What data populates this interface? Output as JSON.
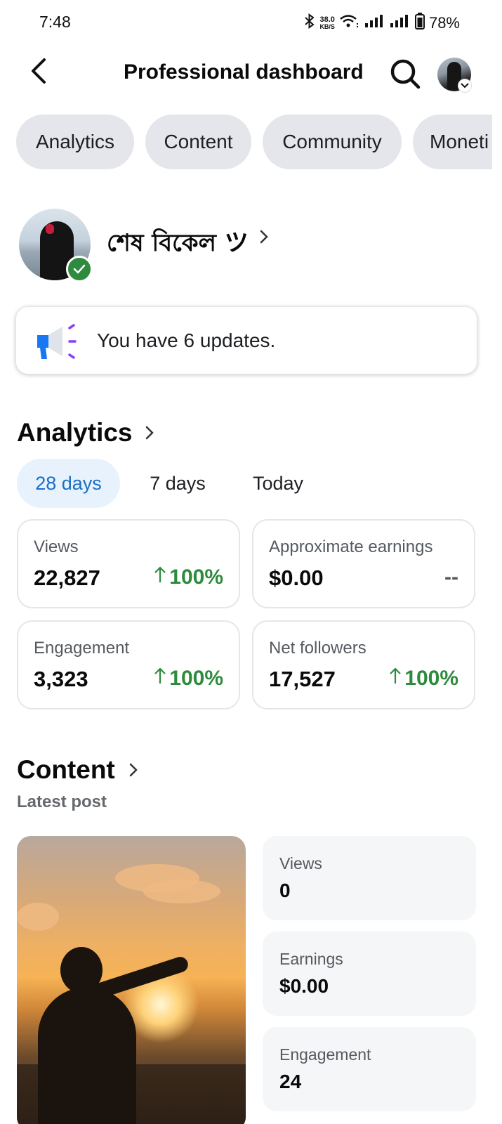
{
  "status_bar": {
    "time": "7:48",
    "net_speed_value": "38.0",
    "net_speed_unit": "KB/S",
    "battery": "78%"
  },
  "header": {
    "title": "Professional dashboard",
    "icons": [
      "back-arrow-icon",
      "search-icon",
      "avatar-menu-icon"
    ]
  },
  "tabs": [
    {
      "label": "Analytics"
    },
    {
      "label": "Content"
    },
    {
      "label": "Community"
    },
    {
      "label": "Moneti"
    }
  ],
  "profile": {
    "name": "শেষ বিকেল ツ",
    "verified": true
  },
  "updates": {
    "text": "You have 6 updates."
  },
  "analytics": {
    "title": "Analytics",
    "periods": [
      {
        "label": "28 days",
        "active": true
      },
      {
        "label": "7 days",
        "active": false
      },
      {
        "label": "Today",
        "active": false
      }
    ],
    "stats": [
      {
        "label": "Views",
        "value": "22,827",
        "change": "100%",
        "direction": "up"
      },
      {
        "label": "Approximate earnings",
        "value": "$0.00",
        "change": "--",
        "direction": "none"
      },
      {
        "label": "Engagement",
        "value": "3,323",
        "change": "100%",
        "direction": "up"
      },
      {
        "label": "Net followers",
        "value": "17,527",
        "change": "100%",
        "direction": "up"
      }
    ]
  },
  "content": {
    "title": "Content",
    "subtitle": "Latest post",
    "metrics": [
      {
        "label": "Views",
        "value": "0"
      },
      {
        "label": "Earnings",
        "value": "$0.00"
      },
      {
        "label": "Engagement",
        "value": "24"
      }
    ]
  },
  "colors": {
    "accent_blue": "#1a6ec6",
    "positive_green": "#2e8b3d",
    "chip_bg": "#e4e6eb"
  }
}
